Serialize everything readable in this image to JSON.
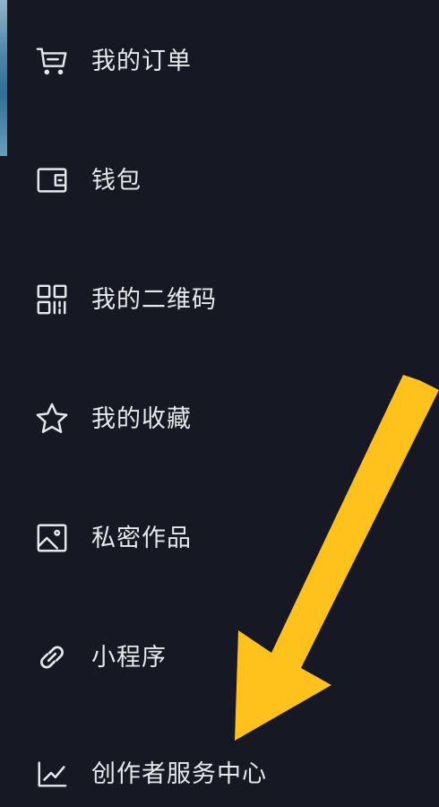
{
  "menu": {
    "items": [
      {
        "label": "我的订单",
        "icon": "cart-icon"
      },
      {
        "label": "钱包",
        "icon": "wallet-icon"
      },
      {
        "label": "我的二维码",
        "icon": "qr-code-icon"
      },
      {
        "label": "我的收藏",
        "icon": "star-icon"
      },
      {
        "label": "私密作品",
        "icon": "private-photo-icon"
      },
      {
        "label": "小程序",
        "icon": "link-icon"
      },
      {
        "label": "创作者服务中心",
        "icon": "chart-trend-icon"
      }
    ]
  },
  "annotation": {
    "arrow_color": "#FFC21C",
    "points_to": "创作者服务中心"
  },
  "colors": {
    "background": "#161823",
    "text": "#E8E8EA",
    "icon": "#E8E8EA"
  }
}
